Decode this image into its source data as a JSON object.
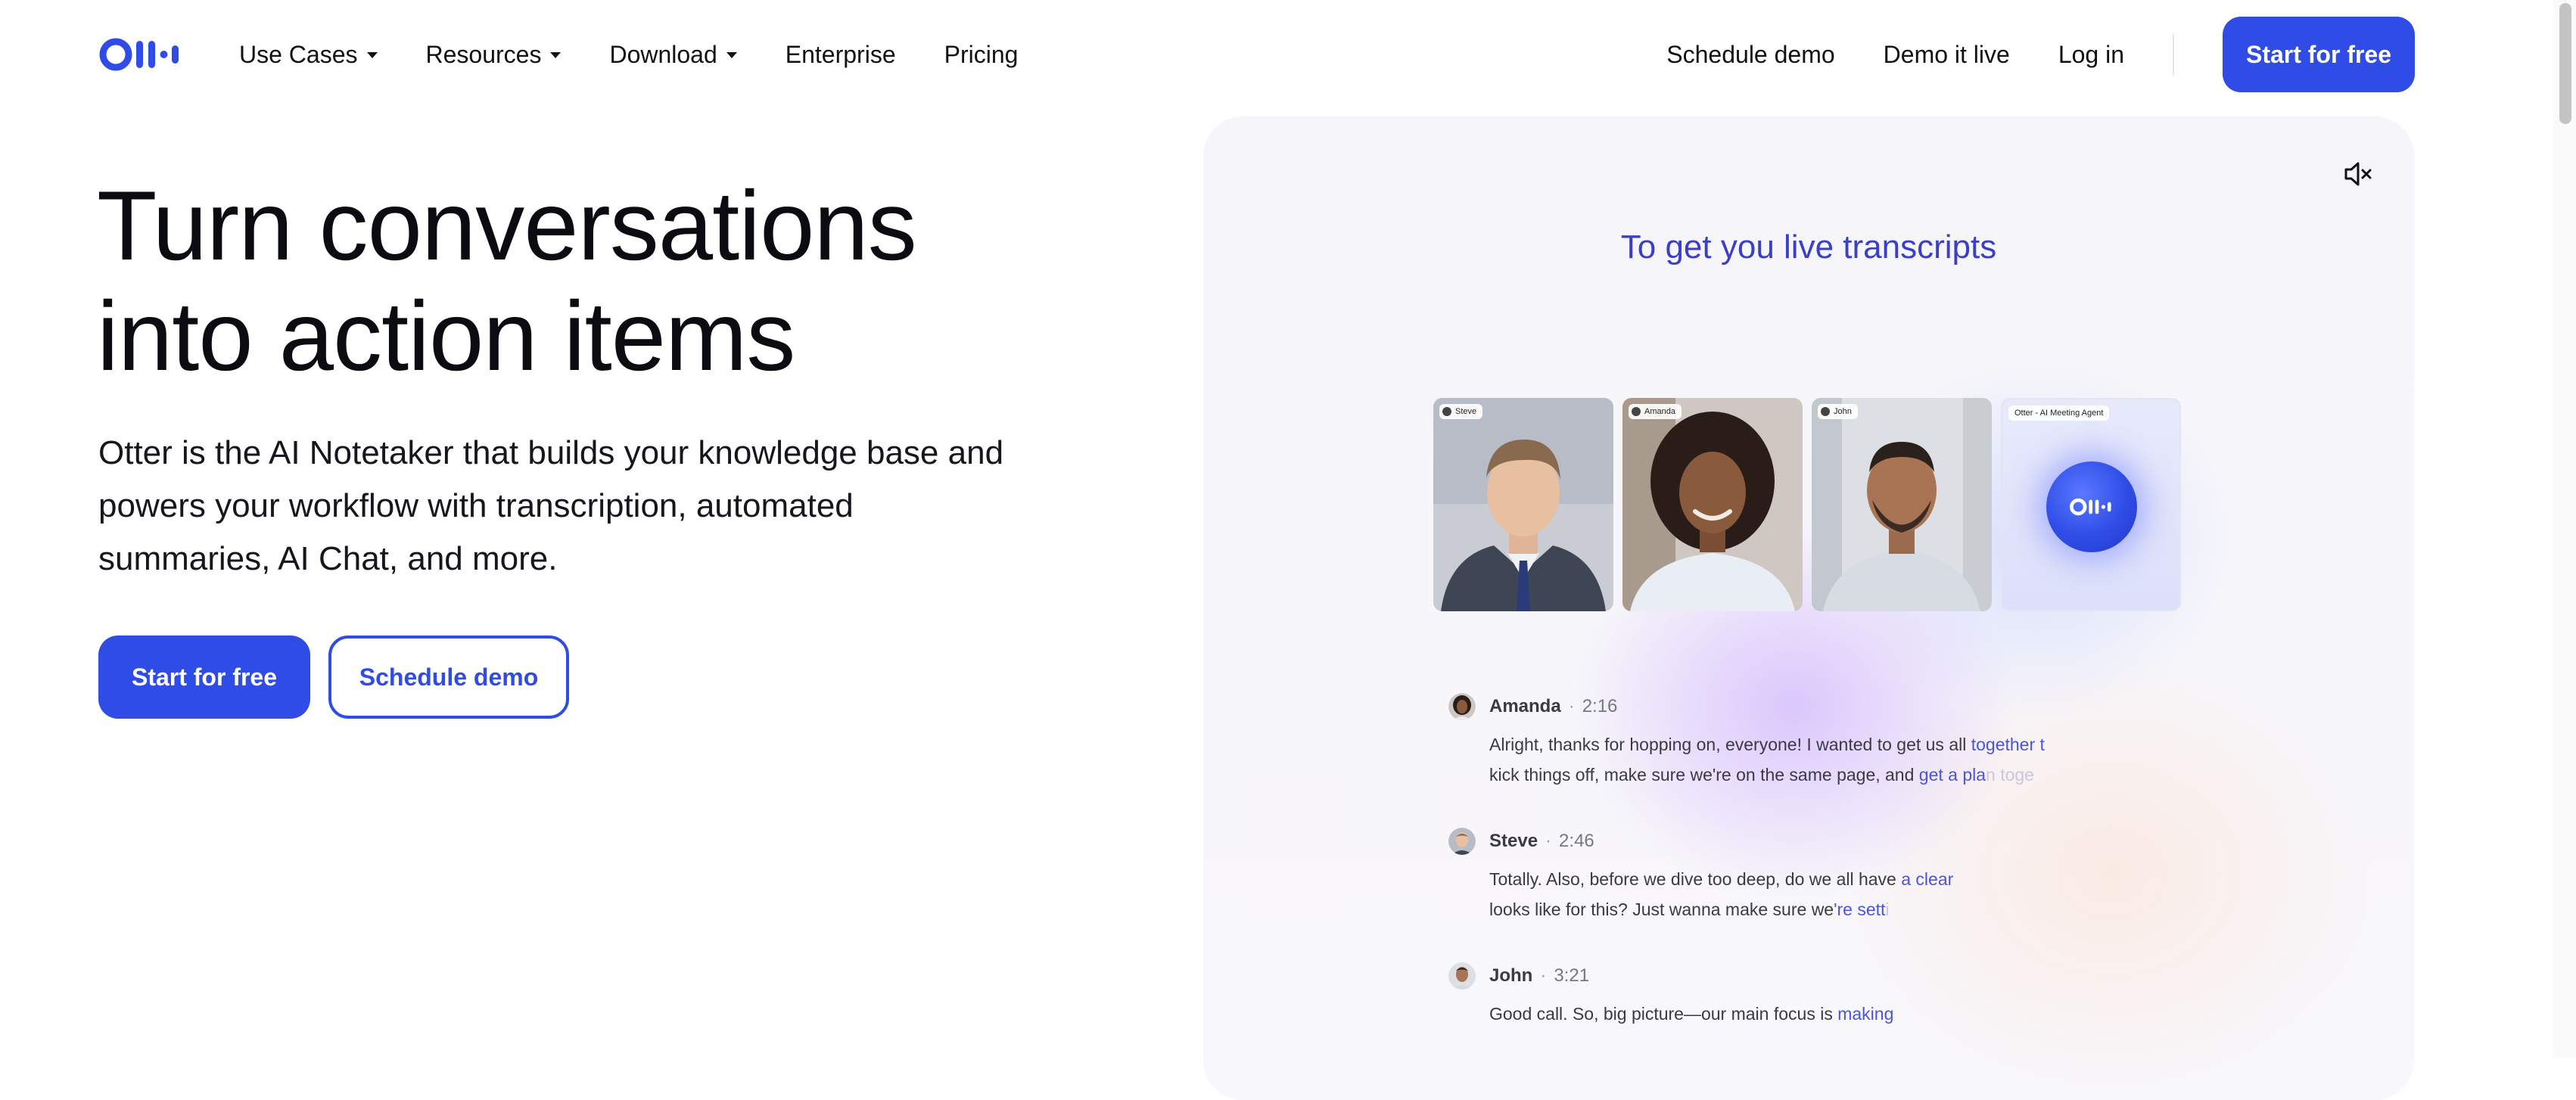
{
  "nav": {
    "logo_alt": "Otter",
    "left_items": [
      {
        "label": "Use Cases",
        "dropdown": true
      },
      {
        "label": "Resources",
        "dropdown": true
      },
      {
        "label": "Download",
        "dropdown": true
      },
      {
        "label": "Enterprise",
        "dropdown": false
      },
      {
        "label": "Pricing",
        "dropdown": false
      }
    ],
    "schedule_demo": "Schedule demo",
    "demo_live": "Demo it live",
    "log_in": "Log in",
    "cta": "Start for free"
  },
  "hero": {
    "title_line1": "Turn conversations",
    "title_line2": "into action items",
    "subtitle": "Otter is the AI Notetaker that builds your knowledge base and powers your workflow with transcription, automated summaries, AI Chat, and more.",
    "cta_primary": "Start for free",
    "cta_secondary": "Schedule demo"
  },
  "demo": {
    "caption": "To get you live transcripts",
    "mute_icon": "speaker-muted-icon",
    "tiles": [
      {
        "tag": "Steve",
        "type": "person"
      },
      {
        "tag": "Amanda",
        "type": "person"
      },
      {
        "tag": "John",
        "type": "person"
      },
      {
        "tag": "Otter - AI Meeting Agent",
        "type": "otter"
      }
    ],
    "transcript": [
      {
        "name": "Amanda",
        "time": "2:16",
        "text_before": "Alright, thanks for hopping on, everyone! I wanted to get us all ",
        "text_highlight": "together t",
        "text_line2": "kick things off, make sure we're on the same page, and ",
        "text_highlight2": "get a pla",
        "text_fade": "n toge"
      },
      {
        "name": "Steve",
        "time": "2:46",
        "text_before": "Totally. Also, before we dive too deep, do we all have ",
        "text_highlight": "a clear",
        "text_line2": "looks like for this? Just wanna make sure we",
        "text_highlight2": "'re sett",
        "text_fade": "i"
      },
      {
        "name": "John",
        "time": "3:21",
        "text_before": "Good call. So, big picture—our main focus is ",
        "text_highlight": "making",
        "text_line2": "",
        "text_highlight2": "",
        "text_fade": ""
      }
    ]
  },
  "colors": {
    "brand": "#2f4de6",
    "caption": "#3a3fc6",
    "highlight": "#4a55d9"
  }
}
